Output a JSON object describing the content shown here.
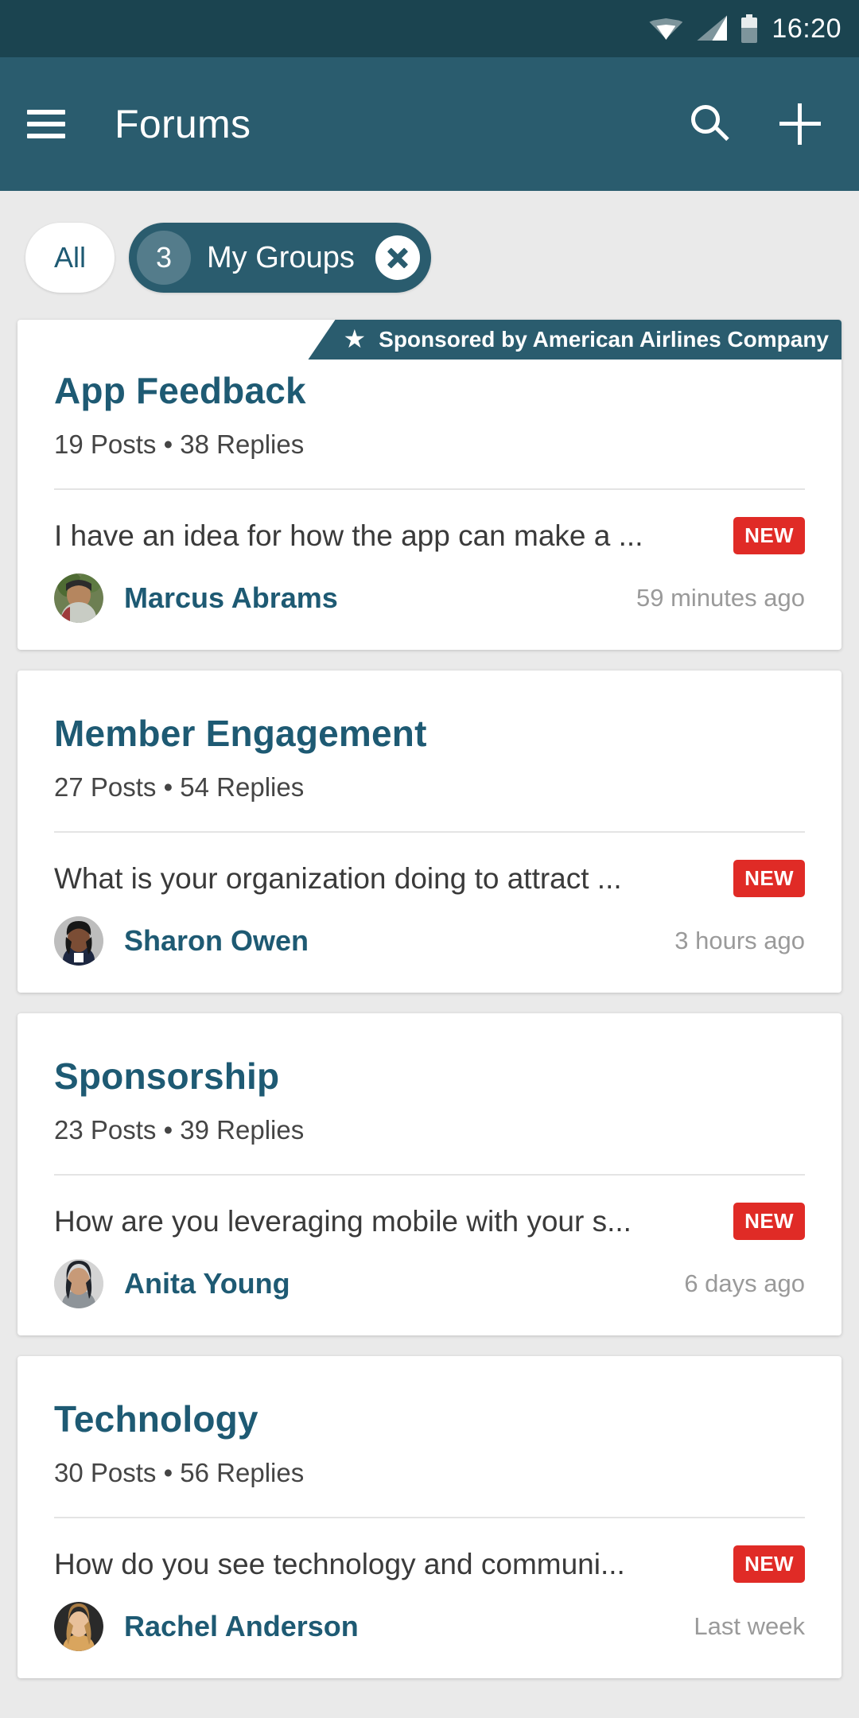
{
  "status_bar": {
    "time": "16:20",
    "icons": [
      "wifi-icon",
      "signal-icon",
      "battery-icon"
    ]
  },
  "app_bar": {
    "menu_icon": "hamburger-menu-icon",
    "title": "Forums",
    "search_icon": "search-icon",
    "add_icon": "plus-icon"
  },
  "filters": {
    "all_label": "All",
    "my_groups": {
      "count": "3",
      "label": "My Groups",
      "close_icon": "close-icon"
    }
  },
  "colors": {
    "status_bar": "#1B4450",
    "app_bar": "#2A5C6E",
    "accent": "#1E5A73",
    "page_bg": "#EAEAEA",
    "new_badge": "#E02B26",
    "card_bg": "#FFFFFF"
  },
  "cards": [
    {
      "sponsored": true,
      "sponsor_text": "Sponsored by American Airlines Company",
      "sponsor_icon": "star-icon",
      "title": "App Feedback",
      "stats": "19 Posts  •  38 Replies",
      "post_title": "I have an idea for how the app can make a ...",
      "badge": "NEW",
      "author": "Marcus Abrams",
      "timestamp": "59 minutes ago"
    },
    {
      "sponsored": false,
      "title": "Member Engagement",
      "stats": "27 Posts  •  54 Replies",
      "post_title": "What is your organization doing to attract ...",
      "badge": "NEW",
      "author": "Sharon Owen",
      "timestamp": "3 hours ago"
    },
    {
      "sponsored": false,
      "title": "Sponsorship",
      "stats": "23 Posts  •  39 Replies",
      "post_title": "How are you leveraging mobile with your s...",
      "badge": "NEW",
      "author": "Anita Young",
      "timestamp": "6 days ago"
    },
    {
      "sponsored": false,
      "title": "Technology",
      "stats": "30 Posts  •  56 Replies",
      "post_title": "How do you see technology and communi...",
      "badge": "NEW",
      "author": "Rachel Anderson",
      "timestamp": "Last week"
    }
  ]
}
